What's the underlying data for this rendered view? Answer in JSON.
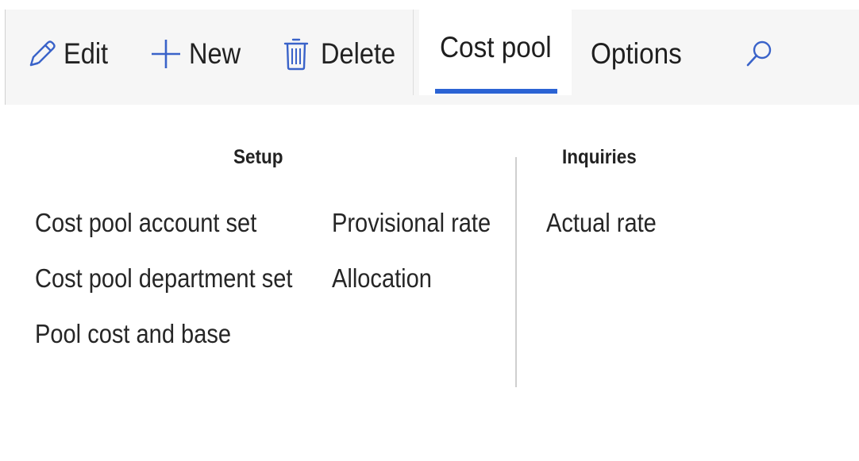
{
  "actionbar": {
    "edit": {
      "label": "Edit",
      "icon": "pencil-icon"
    },
    "new": {
      "label": "New",
      "icon": "plus-icon"
    },
    "delete": {
      "label": "Delete",
      "icon": "trash-icon"
    },
    "search_icon": "search-icon"
  },
  "tabs": [
    {
      "label": "Cost pool",
      "selected": true
    },
    {
      "label": "Options",
      "selected": false
    }
  ],
  "groups": {
    "setup": {
      "header": "Setup",
      "items": [
        "Cost pool account set",
        "Cost pool department set",
        "Pool cost and base",
        "Provisional rate",
        "Allocation"
      ]
    },
    "inquiries": {
      "header": "Inquiries",
      "items": [
        "Actual rate"
      ]
    }
  },
  "colors": {
    "accent": "#2b63d4",
    "icon": "#3a63c9",
    "actionbar_bg": "#f6f6f6",
    "text": "#222222"
  }
}
